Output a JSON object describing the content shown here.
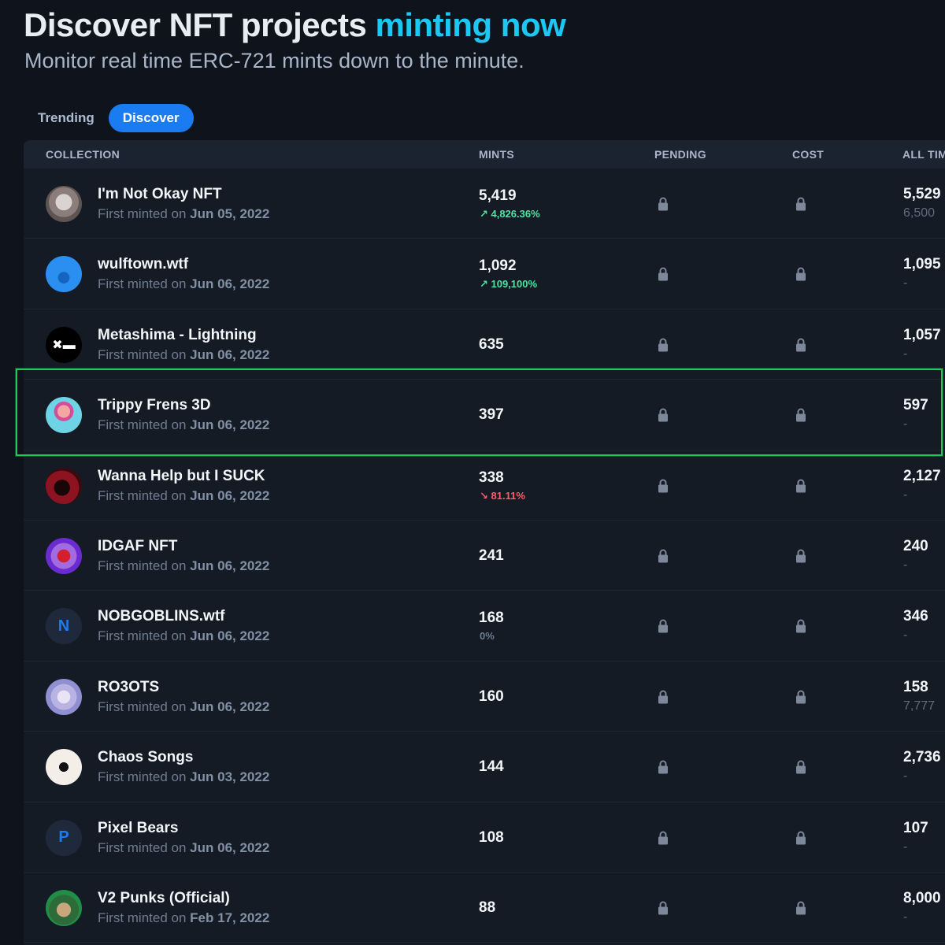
{
  "header": {
    "title_main": "Discover NFT projects",
    "title_accent": "minting now",
    "subtitle": "Monitor real time ERC-721 mints down to the minute."
  },
  "tabs": [
    {
      "label": "Trending",
      "active": false
    },
    {
      "label": "Discover",
      "active": true
    }
  ],
  "table": {
    "columns": {
      "collection": "COLLECTION",
      "mints": "MINTS",
      "pending": "PENDING",
      "cost": "COST",
      "all_time": "ALL TIM"
    },
    "first_minted_label": "First minted on",
    "rows": [
      {
        "name": "I'm Not Okay NFT",
        "date": "Jun 05, 2022",
        "mints": "5,419",
        "change": "↗ 4,826.36%",
        "change_dir": "up",
        "all_time": "5,529",
        "all_sub": "6,500",
        "avatar": "avatar-image"
      },
      {
        "name": "wulftown.wtf",
        "date": "Jun 06, 2022",
        "mints": "1,092",
        "change": "↗ 109,100%",
        "change_dir": "up",
        "all_time": "1,095",
        "all_sub": "-",
        "avatar": "avatar-image"
      },
      {
        "name": "Metashima - Lightning",
        "date": "Jun 06, 2022",
        "mints": "635",
        "change": "",
        "change_dir": "",
        "all_time": "1,057",
        "all_sub": "-",
        "avatar": "avatar-image"
      },
      {
        "name": "Trippy Frens 3D",
        "date": "Jun 06, 2022",
        "mints": "397",
        "change": "",
        "change_dir": "",
        "all_time": "597",
        "all_sub": "-",
        "avatar": "avatar-image"
      },
      {
        "name": "Wanna Help but I SUCK",
        "date": "Jun 06, 2022",
        "mints": "338",
        "change": "↘ 81.11%",
        "change_dir": "down",
        "all_time": "2,127",
        "all_sub": "-",
        "avatar": "avatar-image"
      },
      {
        "name": "IDGAF NFT",
        "date": "Jun 06, 2022",
        "mints": "241",
        "change": "",
        "change_dir": "",
        "all_time": "240",
        "all_sub": "-",
        "avatar": "avatar-image"
      },
      {
        "name": "NOBGOBLINS.wtf",
        "date": "Jun 06, 2022",
        "mints": "168",
        "change": "0%",
        "change_dir": "flat",
        "all_time": "346",
        "all_sub": "-",
        "avatar": "N"
      },
      {
        "name": "RO3OTS",
        "date": "Jun 06, 2022",
        "mints": "160",
        "change": "",
        "change_dir": "",
        "all_time": "158",
        "all_sub": "7,777",
        "avatar": "avatar-image"
      },
      {
        "name": "Chaos Songs",
        "date": "Jun 03, 2022",
        "mints": "144",
        "change": "",
        "change_dir": "",
        "all_time": "2,736",
        "all_sub": "-",
        "avatar": "avatar-image"
      },
      {
        "name": "Pixel Bears",
        "date": "Jun 06, 2022",
        "mints": "108",
        "change": "",
        "change_dir": "",
        "all_time": "107",
        "all_sub": "-",
        "avatar": "P"
      },
      {
        "name": "V2 Punks (Official)",
        "date": "Feb 17, 2022",
        "mints": "88",
        "change": "",
        "change_dir": "",
        "all_time": "8,000",
        "all_sub": "-",
        "avatar": "avatar-image"
      }
    ]
  },
  "colors": {
    "accent": "#1cc7f4",
    "active_tab": "#1b7cf2",
    "up": "#4fe3a0",
    "down": "#ff5a6a",
    "highlight": "#22c55e"
  }
}
